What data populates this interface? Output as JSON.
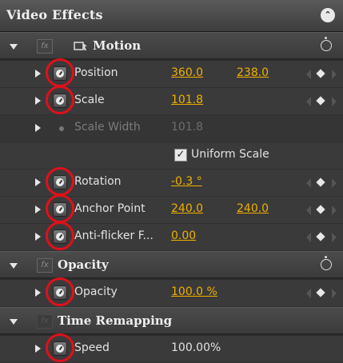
{
  "panel": {
    "title": "Video Effects"
  },
  "motion": {
    "name": "Motion",
    "props": {
      "position": {
        "label": "Position",
        "x": "360.0",
        "y": "238.0"
      },
      "scale": {
        "label": "Scale",
        "value": "101.8"
      },
      "scale_width": {
        "label": "Scale Width",
        "value": "101.8"
      },
      "uniform_scale": {
        "label": "Uniform Scale",
        "checked": true
      },
      "rotation": {
        "label": "Rotation",
        "value": "-0.3 °"
      },
      "anchor_point": {
        "label": "Anchor Point",
        "x": "240.0",
        "y": "240.0"
      },
      "antiflicker": {
        "label": "Anti-flicker F...",
        "value": "0.00"
      }
    }
  },
  "opacity_effect": {
    "name": "Opacity",
    "props": {
      "opacity": {
        "label": "Opacity",
        "value": "100.0 %"
      }
    }
  },
  "time_remapping": {
    "name": "Time Remapping",
    "props": {
      "speed": {
        "label": "Speed",
        "value": "100.00%"
      }
    }
  },
  "colors": {
    "accent": "#f0b000",
    "highlight_ring": "#e0101a"
  }
}
